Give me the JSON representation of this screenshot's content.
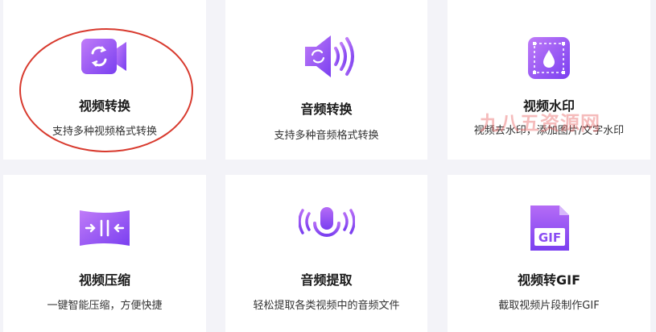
{
  "cards": [
    {
      "title": "视频转换",
      "desc": "支持多种视频格式转换",
      "icon": "video-convert-icon"
    },
    {
      "title": "音频转换",
      "desc": "支持多种音频格式转换",
      "icon": "audio-convert-icon"
    },
    {
      "title": "视频水印",
      "desc": "视频去水印，添加图片/文字水印",
      "icon": "video-watermark-icon"
    },
    {
      "title": "视频压缩",
      "desc": "一键智能压缩，方便快捷",
      "icon": "video-compress-icon"
    },
    {
      "title": "音频提取",
      "desc": "轻松提取各类视频中的音频文件",
      "icon": "audio-extract-icon"
    },
    {
      "title": "视频转GIF",
      "desc": "截取视频片段制作GIF",
      "icon": "video-to-gif-icon"
    }
  ],
  "gif_badge": "GIF",
  "watermark": "九八五资源网",
  "colors": {
    "accent_start": "#b56cf6",
    "accent_end": "#7a3ff0",
    "highlight_circle": "#d83a2e"
  }
}
